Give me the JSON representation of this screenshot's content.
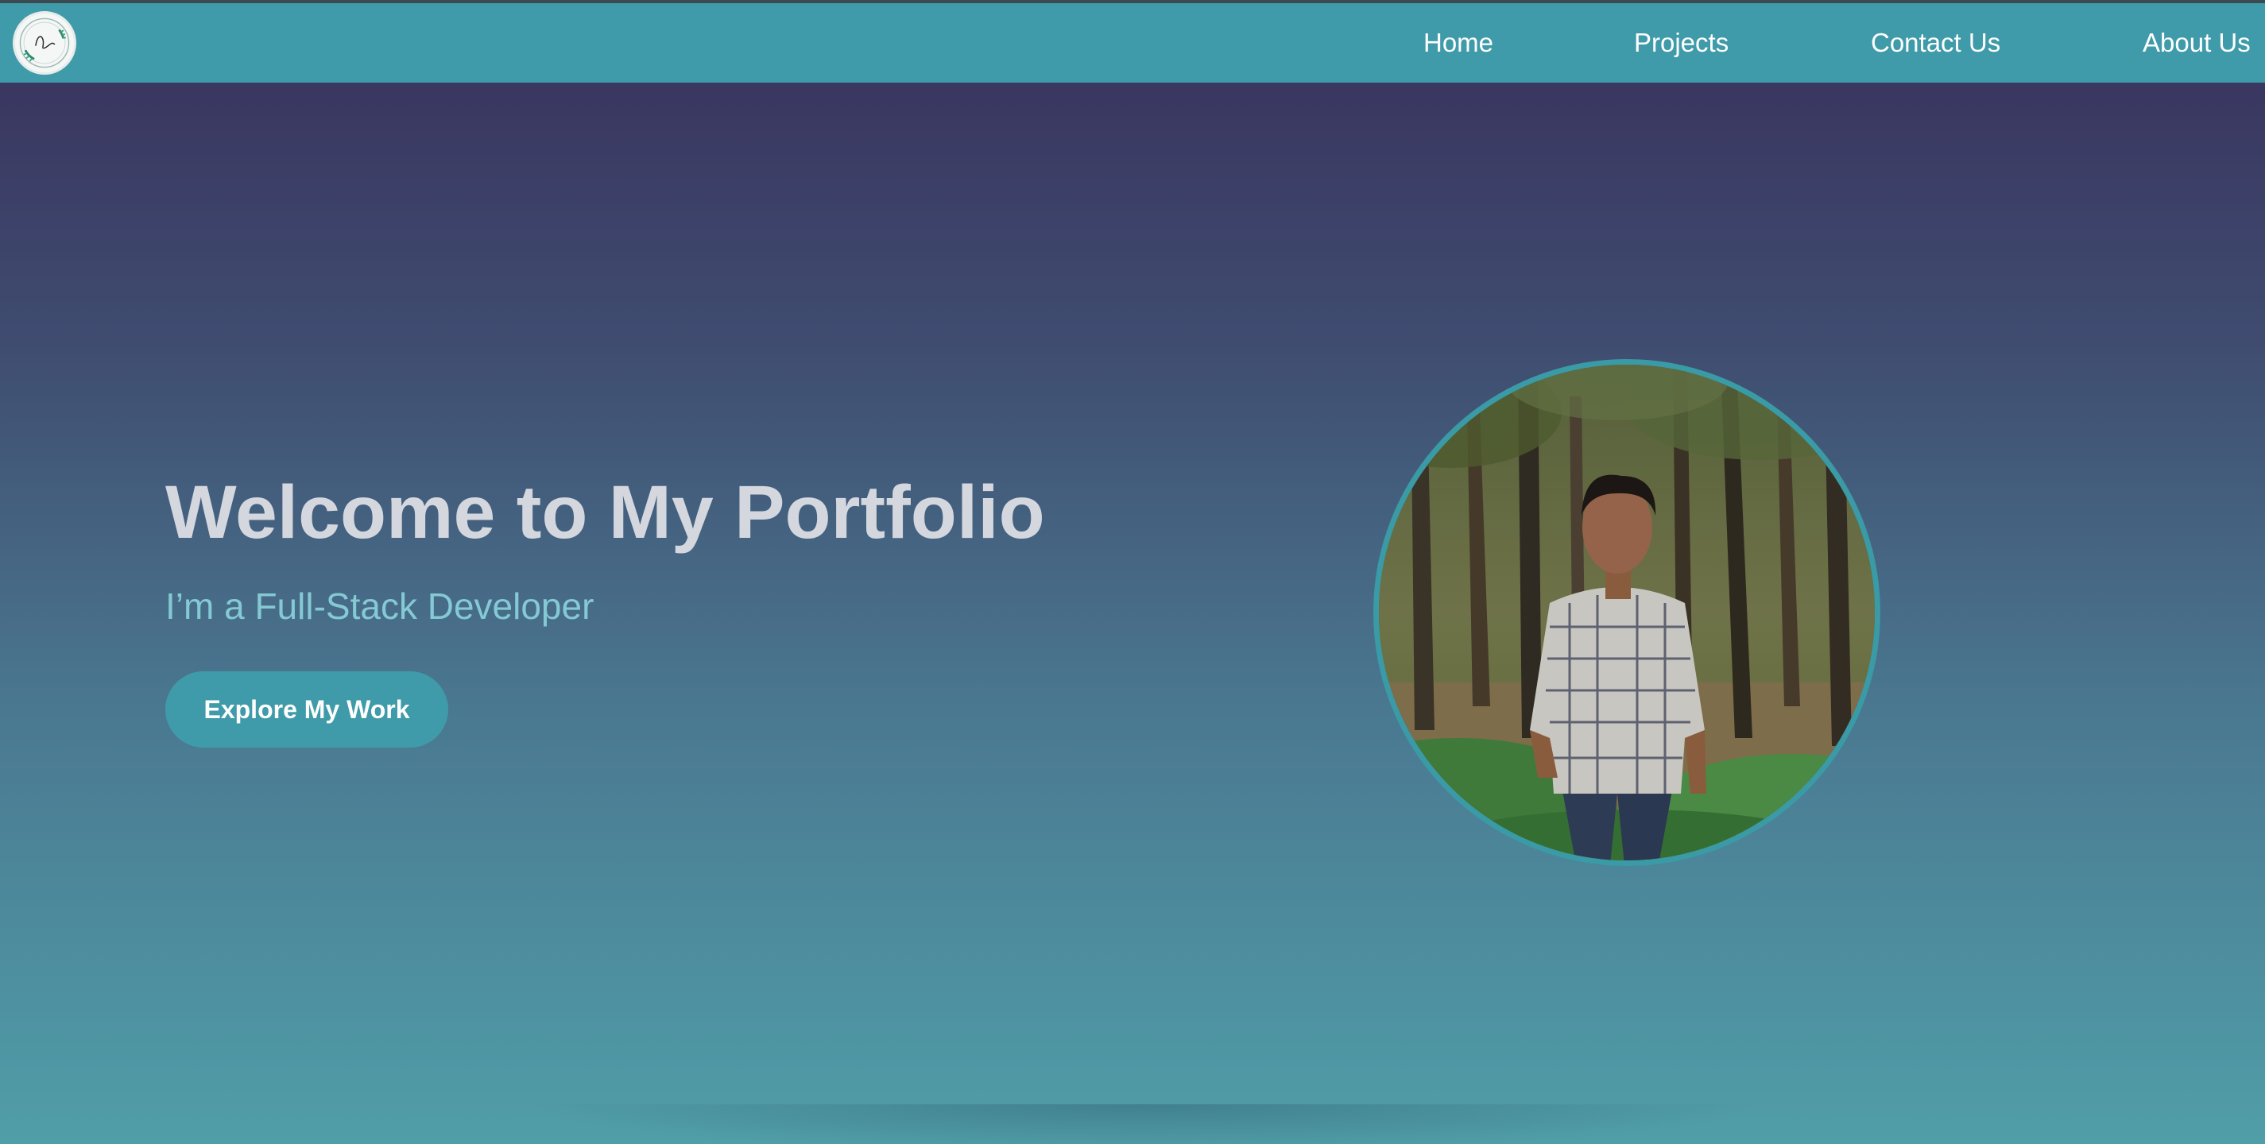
{
  "nav": {
    "logo_text": "Irfan",
    "links": [
      {
        "label": "Home"
      },
      {
        "label": "Projects"
      },
      {
        "label": "Contact Us"
      },
      {
        "label": "About Us"
      }
    ]
  },
  "hero": {
    "title": "Welcome to My Portfolio",
    "subtitle": "I’m a Full-Stack Developer",
    "cta_label": "Explore My Work",
    "portrait_icon": "profile-photo"
  },
  "colors": {
    "nav_bg": "#3f9ba9",
    "accent": "#3f9ba9",
    "title": "#d4d7de",
    "subtitle": "#84c9d3",
    "gradient_top": "#38305c",
    "gradient_bottom": "#509ea8"
  }
}
